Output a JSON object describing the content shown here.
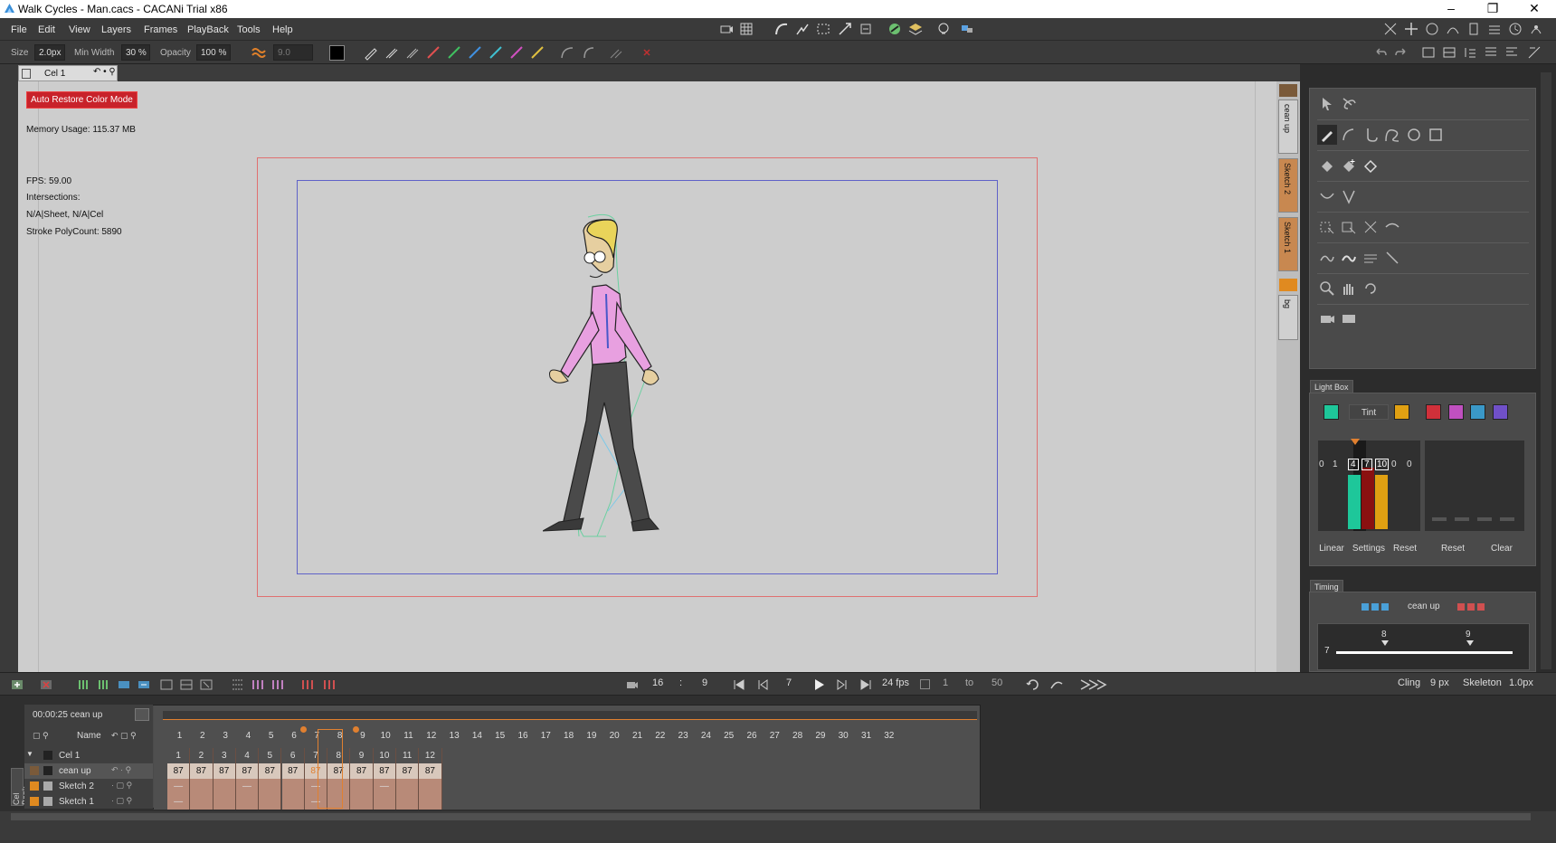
{
  "window": {
    "title": "Walk Cycles - Man.cacs - CACANi Trial  x86"
  },
  "menu": [
    "File",
    "Edit",
    "View",
    "Layers",
    "Frames",
    "PlayBack",
    "Tools",
    "Help"
  ],
  "options": {
    "size_label": "Size",
    "size_value": "2.0px",
    "minwidth_label": "Min Width",
    "minwidth_value": "30 %",
    "opacity_label": "Opacity",
    "opacity_value": "100 %",
    "smooth_value": "9.0"
  },
  "cel_tab": {
    "label": "Cel 1"
  },
  "canvas": {
    "auto_restore": "Auto Restore Color Mode",
    "memory": "Memory Usage: 115.37 MB",
    "fps": "FPS: 59.00",
    "intersections": "Intersections:",
    "sheet": "N/A|Sheet, N/A|Cel",
    "polycount": "Stroke PolyCount: 5890"
  },
  "layer_tabs": [
    "cean up",
    "Sketch 2",
    "Sketch 1",
    "bg"
  ],
  "lightbox": {
    "title": "Light Box",
    "tint": "Tint",
    "colors": {
      "green": "#1ec79a",
      "orange": "#e0a012",
      "red": "#d0303a",
      "magenta": "#c050c0",
      "cyan": "#3a98c8",
      "purple": "#7050c8"
    },
    "numbers": [
      "0",
      "1",
      "4",
      "7",
      "10",
      "0",
      "0"
    ],
    "buttons": [
      "Linear",
      "Settings",
      "Reset",
      "Reset",
      "Clear"
    ]
  },
  "timing": {
    "title": "Timing",
    "layer": "cean up",
    "left_val": "7",
    "mark1": "8",
    "mark2": "9"
  },
  "playback": {
    "frame_a": "16",
    "colon": ":",
    "frame_b": "9",
    "current": "7",
    "fps": "24 fps",
    "range_from": "1",
    "to_label": "to",
    "range_to": "50",
    "cling_label": "Cling",
    "cling_value": "9 px",
    "skeleton_label": "Skeleton",
    "skeleton_value": "1.0px"
  },
  "xsheet": {
    "time": "00:00:25  cean up",
    "name_header": "Name",
    "frames": [
      "1",
      "2",
      "3",
      "4",
      "5",
      "6",
      "7",
      "8",
      "9",
      "10",
      "11",
      "12",
      "13",
      "14",
      "15",
      "16",
      "17",
      "18",
      "19",
      "20",
      "21",
      "22",
      "23",
      "24",
      "25",
      "26",
      "27",
      "28",
      "29",
      "30",
      "31",
      "32"
    ],
    "layers": [
      {
        "name": "Cel 1",
        "cells": [
          "1",
          "2",
          "3",
          "4",
          "5",
          "6",
          "7",
          "8",
          "9",
          "10",
          "11",
          "12"
        ]
      },
      {
        "name": "cean up",
        "cells": [
          "87",
          "87",
          "87",
          "87",
          "87",
          "87",
          "87",
          "87",
          "87",
          "87",
          "87",
          "87"
        ]
      },
      {
        "name": "Sketch 2",
        "cells": [
          "—",
          "",
          "",
          "—",
          "",
          "",
          "—",
          "",
          "",
          "—",
          "",
          ""
        ]
      },
      {
        "name": "Sketch 1",
        "cells": [
          "—",
          "",
          "",
          "",
          "",
          "",
          "—",
          "",
          "",
          "",
          "",
          ""
        ]
      }
    ],
    "cel_bank": "Cel Bank"
  }
}
